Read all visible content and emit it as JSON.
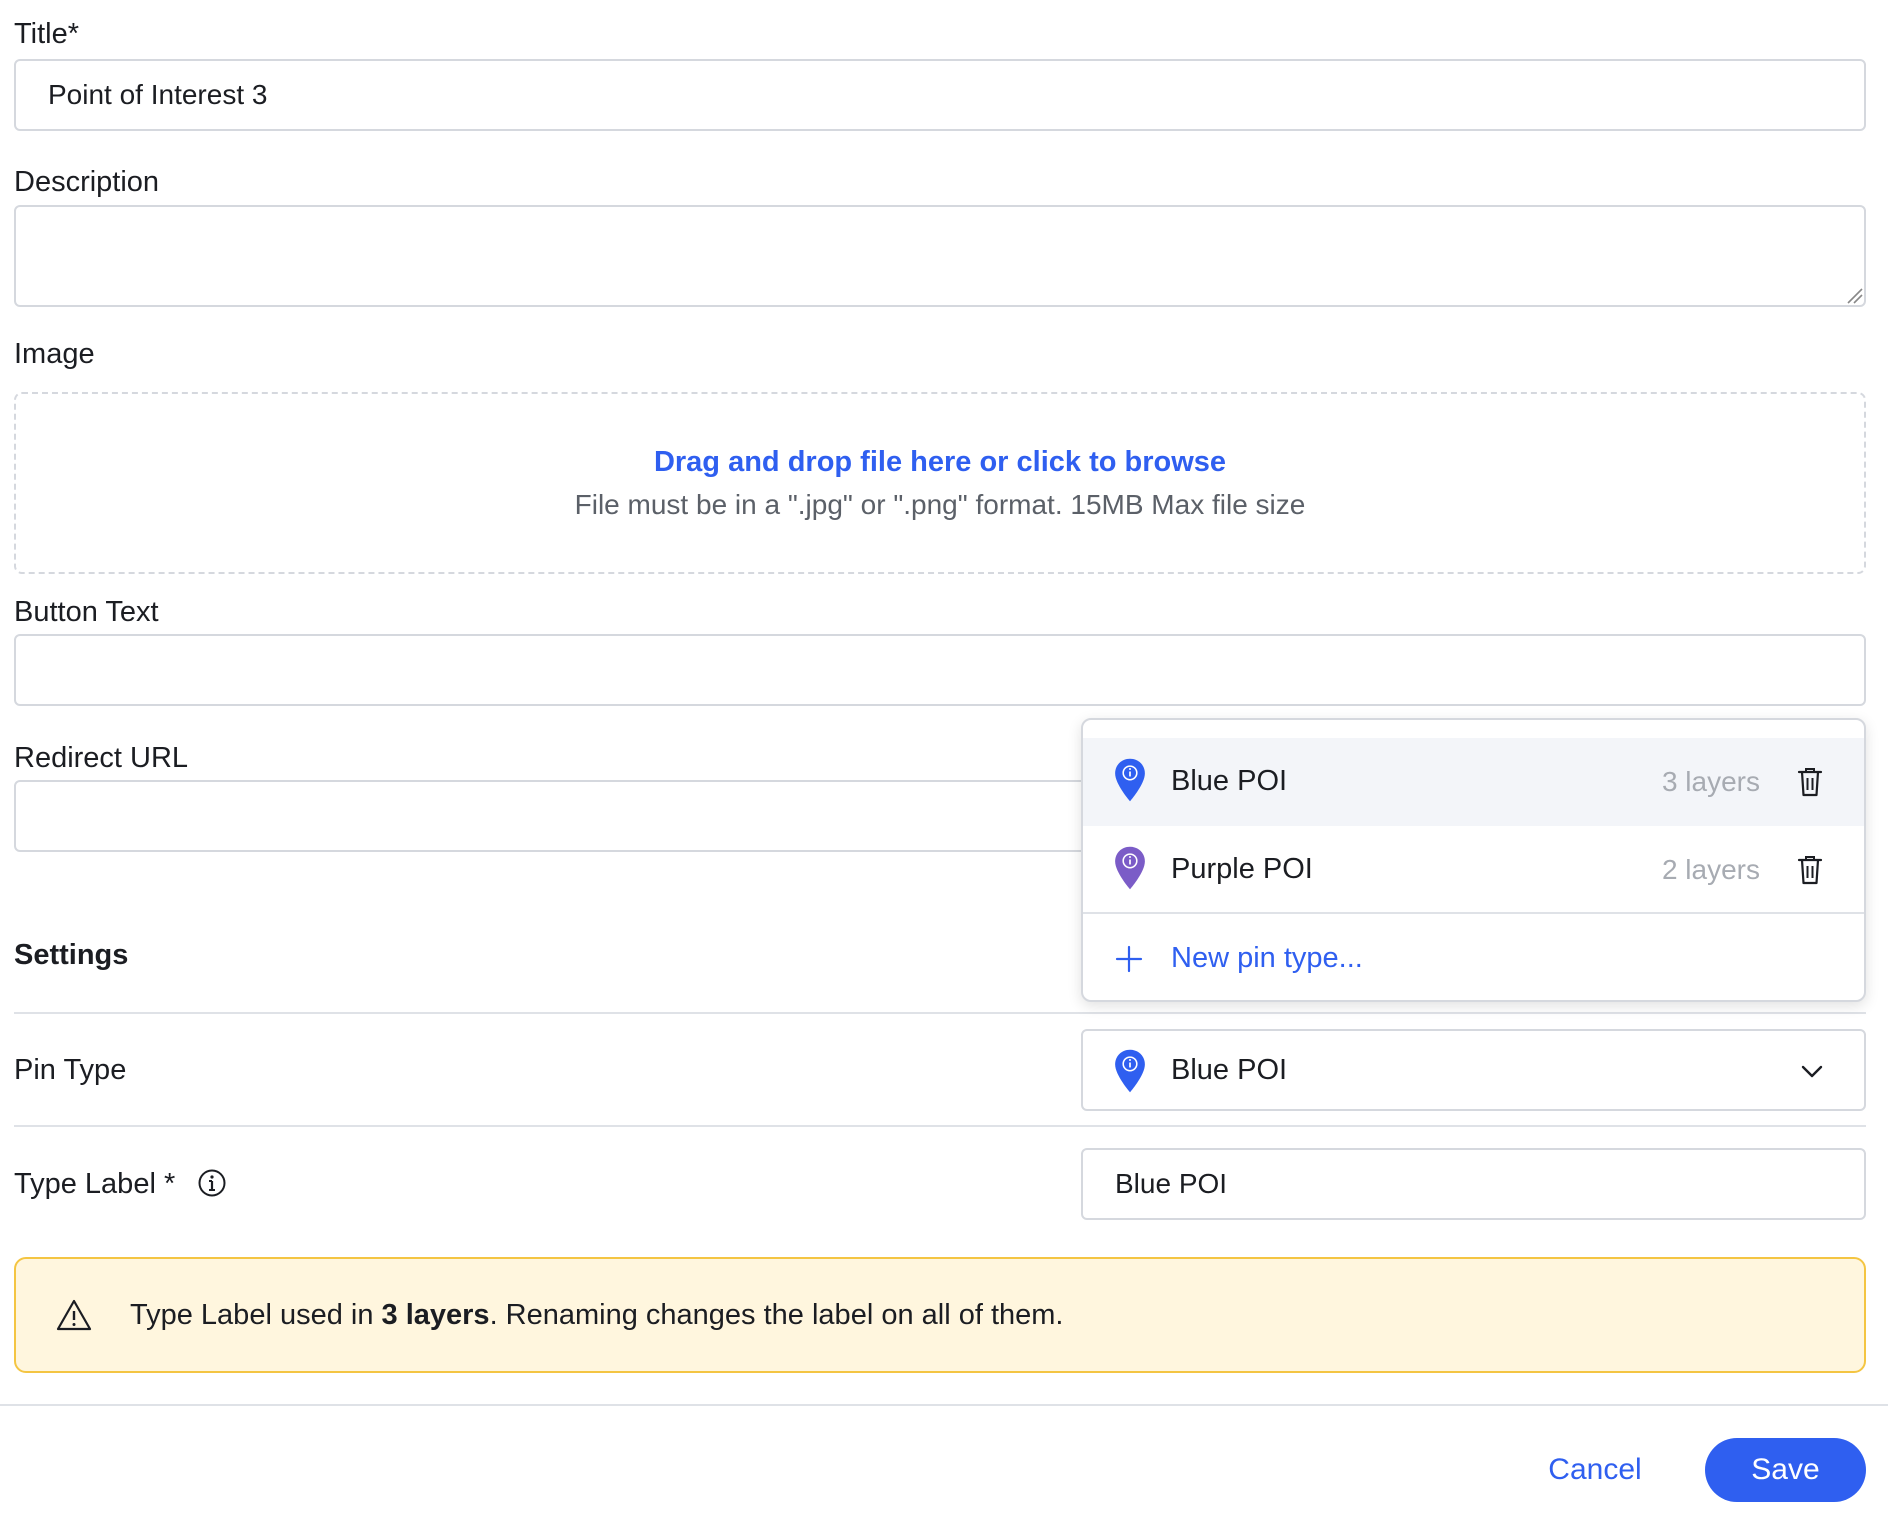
{
  "form": {
    "title": {
      "label": "Title*",
      "value": "Point of Interest 3"
    },
    "description": {
      "label": "Description",
      "value": ""
    },
    "image": {
      "label": "Image",
      "drop_link": "Drag and drop file here or click to browse",
      "drop_hint": "File must be in a \".jpg\" or \".png\" format. 15MB Max file size"
    },
    "button_text": {
      "label": "Button Text",
      "value": ""
    },
    "redirect_url": {
      "label": "Redirect URL",
      "value": ""
    }
  },
  "settings": {
    "heading": "Settings",
    "pin_type": {
      "label": "Pin Type",
      "selected": "Blue POI"
    },
    "type_label": {
      "label": "Type Label *",
      "value": "Blue POI"
    }
  },
  "pin_dropdown": {
    "options": [
      {
        "name": "Blue POI",
        "count": "3 layers",
        "color": "#2f5ff0",
        "selected": true
      },
      {
        "name": "Purple POI",
        "count": "2 layers",
        "color": "#7b5cc7",
        "selected": false
      }
    ],
    "new_label": "New pin type..."
  },
  "warning": {
    "text_before": "Type Label used in ",
    "bold": "3 layers",
    "text_after": ". Renaming changes the label on all of them."
  },
  "footer": {
    "cancel": "Cancel",
    "save": "Save"
  },
  "colors": {
    "accent": "#2f5ff0",
    "purple_pin": "#7b5cc7",
    "warning_border": "#f4c542",
    "warning_bg": "#fff6de"
  },
  "icons": {
    "pin": "map-pin-icon",
    "delete": "trash-icon",
    "add": "plus-icon",
    "chevron": "chevron-down-icon",
    "info": "info-icon",
    "warning": "warning-triangle-icon"
  }
}
